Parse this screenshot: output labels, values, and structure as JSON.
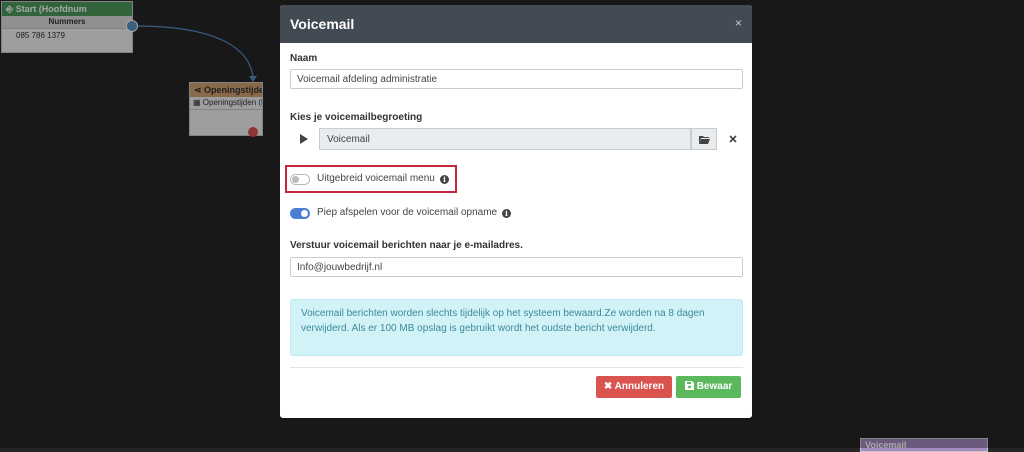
{
  "canvas": {
    "start_node": {
      "title": "Start (Hoofdnum",
      "row_label": "Nummers",
      "number": "085 786 1379"
    },
    "opening_node": {
      "title": "Openingstijden",
      "row_label": "Openingstijden (Binnen"
    },
    "voicemail_node": {
      "title": "Voicemail"
    }
  },
  "modal": {
    "title": "Voicemail",
    "close_glyph": "×",
    "name_label": "Naam",
    "name_value": "Voicemail afdeling administratie",
    "greeting_label": "Kies je voicemailbegroeting",
    "greeting_value": "Voicemail",
    "extended_menu_label": "Uitgebreid voicemail menu",
    "beep_label": "Piep afspelen voor de voicemail opname",
    "email_label": "Verstuur voicemail berichten naar je e-mailadres.",
    "email_value": "Info@jouwbedrijf.nl",
    "info_line1": "Voicemail berichten worden slechts tijdelijk op het systeem bewaard.Ze worden na 8 dagen",
    "info_line2": "verwijderd. Als er 100 MB opslag is gebruikt wordt het oudste bericht verwijderd.",
    "cancel_label": "Annuleren",
    "save_label": "Bewaar",
    "extended_menu_enabled": false,
    "beep_enabled": true
  },
  "colors": {
    "header_bg": "#424a54",
    "toggle_on": "#4a7fd4",
    "danger": "#d9534f",
    "success": "#5cb85c",
    "highlight": "#c5283d",
    "info_bg": "#d1f3f8"
  },
  "icons": {
    "play": "play-icon",
    "folder": "folder-open-icon",
    "clear": "times-icon",
    "info": "info-icon",
    "cancel": "times-icon",
    "save": "save-icon"
  }
}
